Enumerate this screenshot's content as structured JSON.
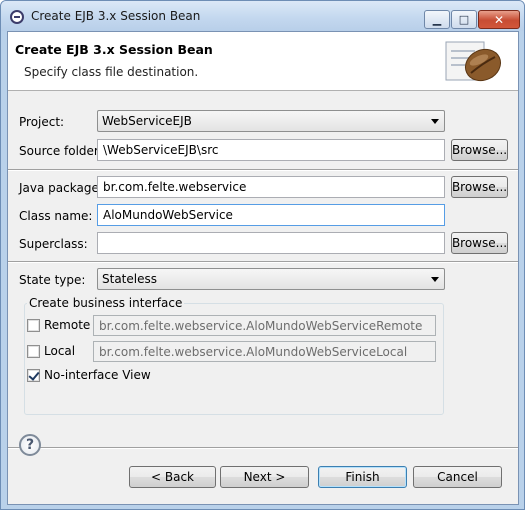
{
  "window": {
    "title": "Create EJB 3.x Session Bean",
    "minimize_glyph": "▁",
    "maximize_glyph": "□",
    "close_glyph": "✕"
  },
  "banner": {
    "title": "Create EJB 3.x Session Bean",
    "subtitle": "Specify class file destination."
  },
  "form": {
    "project": {
      "label": "Project:",
      "value": "WebServiceEJB"
    },
    "source_folder": {
      "label": "Source folder:",
      "value": "\\WebServiceEJB\\src",
      "browse": "Browse..."
    },
    "java_package": {
      "label": "Java package:",
      "value": "br.com.felte.webservice",
      "browse": "Browse..."
    },
    "class_name": {
      "label": "Class name:",
      "value": "AloMundoWebService"
    },
    "superclass": {
      "label": "Superclass:",
      "value": "",
      "browse": "Browse..."
    },
    "state_type": {
      "label": "State type:",
      "value": "Stateless"
    }
  },
  "business_interface": {
    "legend": "Create business interface",
    "remote": {
      "label": "Remote",
      "checked": false,
      "value": "br.com.felte.webservice.AloMundoWebServiceRemote"
    },
    "local": {
      "label": "Local",
      "checked": false,
      "value": "br.com.felte.webservice.AloMundoWebServiceLocal"
    },
    "no_interface": {
      "label": "No-interface View",
      "checked": true
    }
  },
  "footer": {
    "help_glyph": "?",
    "back": "< Back",
    "next": "Next >",
    "finish": "Finish",
    "cancel": "Cancel"
  },
  "icons": {
    "window_icon": "eclipse-icon",
    "banner_icon": "coffee-bean-icon",
    "help_icon": "help-icon"
  }
}
